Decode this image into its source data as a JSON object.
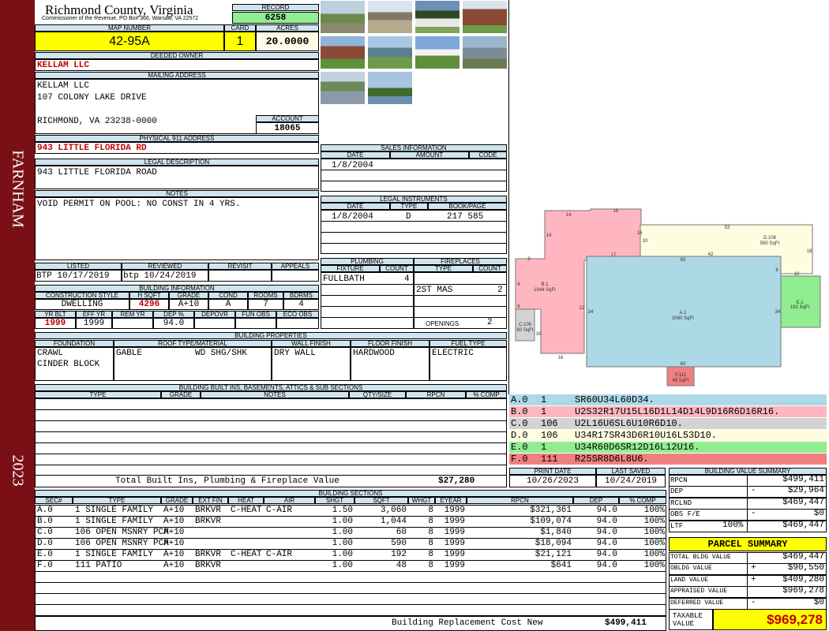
{
  "sidebar": {
    "town": "FARNHAM",
    "year": "2023"
  },
  "header": {
    "county": "Richmond County, Virginia",
    "commissioner": "Commissioner of the Revenue, PO Box 366, Warsaw, VA 22572",
    "record_label": "RECORD",
    "record": "6258",
    "map_label": "MAP NUMBER",
    "map_number": "42-95A",
    "card_label": "CARD",
    "card": "1",
    "acres_label": "ACRES",
    "acres": "20.0000"
  },
  "owner": {
    "deeded_label": "DEEDED OWNER",
    "deeded": "KELLAM LLC",
    "mailing_label": "MAILING ADDRESS",
    "mail_line1": "KELLAM LLC",
    "mail_line2": "107 COLONY LAKE DRIVE",
    "mail_line3": "RICHMOND, VA 23238-0000",
    "account_label": "ACCOUNT",
    "account": "18065",
    "phys_label": "PHYSICAL 911 ADDRESS",
    "phys": "943 LITTLE FLORIDA RD",
    "legal_label": "LEGAL DESCRIPTION",
    "legal": "943 LITTLE FLORIDA ROAD",
    "notes_label": "NOTES",
    "notes": "VOID PERMIT ON POOL: NO CONST IN 4 YRS."
  },
  "status": {
    "listed_label": "LISTED",
    "listed": "BTP 10/17/2019",
    "reviewed_label": "REVIEWED",
    "reviewed": "btp 10/24/2019",
    "revisit_label": "REVISIT",
    "appeals_label": "APPEALS"
  },
  "building_info": {
    "label": "BUILDING INFORMATION",
    "cols": [
      "CONSTRUCTION STYLE",
      "H SQFT",
      "GRADE",
      "COND",
      "ROOMS",
      "BDRMS"
    ],
    "vals": [
      "DWELLING",
      "4296",
      "A+10",
      "A",
      "7",
      "4"
    ],
    "cols2": [
      "YR BLT",
      "EFF YR",
      "REM YR",
      "DEP %",
      "DEPOVR",
      "FUN OBS",
      "ECO OBS"
    ],
    "vals2": [
      "1999",
      "1999",
      "",
      "94.0",
      "",
      "",
      ""
    ]
  },
  "sales": {
    "label": "SALES INFORMATION",
    "cols": [
      "DATE",
      "AMOUNT",
      "CODE"
    ],
    "rows": [
      {
        "date": "1/8/2004",
        "amount": "",
        "code": ""
      }
    ]
  },
  "legal_instr": {
    "label": "LEGAL INSTRUMENTS",
    "cols": [
      "DATE",
      "TYPE",
      "BOOK/PAGE"
    ],
    "rows": [
      {
        "date": "1/8/2004",
        "type": "D",
        "book": "217 585"
      }
    ]
  },
  "plumbing": {
    "label": "PLUMBING",
    "cols": [
      "FIXTURE",
      "COUNT"
    ],
    "rows": [
      {
        "fixture": "FULLBATH",
        "count": "4"
      }
    ]
  },
  "fireplaces": {
    "label": "FIREPLACES",
    "cols": [
      "TYPE",
      "COUNT"
    ],
    "rows": [
      {
        "type": "2ST MAS",
        "count": "2"
      }
    ],
    "openings_label": "OPENINGS",
    "openings": "2"
  },
  "properties": {
    "label": "BUILDING PROPERTIES",
    "cols": [
      "FOUNDATION",
      "ROOF TYPE/MATERIAL",
      "WALL FINISH",
      "FLOOR FINISH",
      "FUEL TYPE"
    ],
    "foundation": [
      "CRAWL",
      "CINDER BLOCK"
    ],
    "roof_type": "GABLE",
    "roof_mat": "WD SHG/SHK",
    "wall": "DRY WALL",
    "floor": "HARDWOOD",
    "fuel": "ELECTRIC"
  },
  "builtins": {
    "label": "BUILDING BUILT INS, BASEMENTS, ATTICS & SUB SECTIONS",
    "cols": [
      "TYPE",
      "GRADE",
      "NOTES",
      "QTY/SIZE",
      "RPCN",
      "% COMP"
    ],
    "total_label": "Total Built Ins, Plumbing & Fireplace Value",
    "total": "$27,280"
  },
  "sketch": {
    "areas": [
      {
        "label": "B.1",
        "sub": "1044 SqFt"
      },
      {
        "label": "D.106",
        "sub": "590 SqFt"
      },
      {
        "label": "A.1",
        "sub": "3060 SqFt"
      },
      {
        "label": "E.1",
        "sub": "192 SqFt"
      },
      {
        "label": "C.106",
        "sub": "60 SqFt"
      },
      {
        "label": "F.111",
        "sub": "48 SqFt"
      }
    ],
    "dims": [
      "14",
      "16",
      "14",
      "16",
      "10",
      "53",
      "D.106",
      "42",
      "18",
      "60",
      "17",
      "9",
      "6",
      "22",
      "34",
      "34",
      "10",
      "8",
      "16",
      "16",
      "60",
      "6"
    ],
    "codes": [
      {
        "id": "A.0",
        "n": "1",
        "code": "SR60U34L60D34.",
        "color": "#add8e6"
      },
      {
        "id": "B.0",
        "n": "1",
        "code": "U2S32R17U15L16D1L14D14L9D16R6D16R16.",
        "color": "#ffb6c1"
      },
      {
        "id": "C.0",
        "n": "106",
        "code": "U2L16U6SL6U10R6D10.",
        "color": "#d3d3d3"
      },
      {
        "id": "D.0",
        "n": "106",
        "code": "U34R17SR43D6R10U16L53D10.",
        "color": "#fffde0"
      },
      {
        "id": "E.0",
        "n": "1",
        "code": "U34R60D6SR12D16L12U16.",
        "color": "#90ee90"
      },
      {
        "id": "F.0",
        "n": "111",
        "code": "R25SR8D6L8U6.",
        "color": "#f08080"
      }
    ]
  },
  "print": {
    "print_label": "PRINT DATE",
    "print_date": "10/26/2023",
    "saved_label": "LAST SAVED",
    "saved": "10/24/2019"
  },
  "bvs": {
    "label": "BUILDING VALUE SUMMARY",
    "rows": [
      {
        "k": "RPCN",
        "sign": "",
        "pct": "",
        "v": "$499,411"
      },
      {
        "k": "DEP",
        "sign": "-",
        "pct": "",
        "v": "$29,964"
      },
      {
        "k": "RCLND",
        "sign": "",
        "pct": "",
        "v": "$469,447"
      },
      {
        "k": "OBS F/E",
        "sign": "-",
        "pct": "",
        "v": "$0"
      },
      {
        "k": "LTF",
        "sign": "",
        "pct": "100%",
        "v": "$469,447"
      }
    ]
  },
  "parcel": {
    "label": "PARCEL SUMMARY",
    "rows": [
      {
        "k": "TOTAL BLDG VALUE",
        "sign": "",
        "v": "$469,447"
      },
      {
        "k": "OBLDG VALUE",
        "sign": "+",
        "v": "$90,550"
      },
      {
        "k": "LAND VALUE",
        "sign": "+",
        "v": "$409,280"
      },
      {
        "k": "APPRAISED VALUE",
        "sign": "",
        "v": "$969,278"
      },
      {
        "k": "DEFERRED VALUE",
        "sign": "-",
        "v": "$0"
      }
    ],
    "taxable_label": "TAXABLE VALUE",
    "taxable": "$969,278"
  },
  "sections": {
    "label": "BUILDING SECTIONS",
    "cols": [
      "SEC#",
      "TYPE",
      "GRADE",
      "EXT FIN",
      "HEAT",
      "AIR",
      "SHGT",
      "SQFT",
      "WHGT",
      "EYEAR",
      "RPCN",
      "DEP",
      "% COMP"
    ],
    "rows": [
      {
        "sec": "A.0",
        "type": "1 SINGLE FAMILY",
        "grade": "A+10",
        "ext": "BRKVR",
        "heat": "C-HEAT",
        "air": "C-AIR",
        "shgt": "1.50",
        "sqft": "3,060",
        "whgt": "8",
        "eyear": "1999",
        "rpcn": "$321,361",
        "dep": "94.0",
        "comp": "100%"
      },
      {
        "sec": "B.0",
        "type": "1 SINGLE FAMILY",
        "grade": "A+10",
        "ext": "BRKVR",
        "heat": "",
        "air": "",
        "shgt": "1.00",
        "sqft": "1,044",
        "whgt": "8",
        "eyear": "1999",
        "rpcn": "$109,074",
        "dep": "94.0",
        "comp": "100%"
      },
      {
        "sec": "C.0",
        "type": "106 OPEN MSNRY PCH",
        "grade": "A+10",
        "ext": "",
        "heat": "",
        "air": "",
        "shgt": "1.00",
        "sqft": "60",
        "whgt": "8",
        "eyear": "1999",
        "rpcn": "$1,840",
        "dep": "94.0",
        "comp": "100%"
      },
      {
        "sec": "D.0",
        "type": "106 OPEN MSNRY PCH",
        "grade": "A+10",
        "ext": "",
        "heat": "",
        "air": "",
        "shgt": "1.00",
        "sqft": "590",
        "whgt": "8",
        "eyear": "1999",
        "rpcn": "$18,094",
        "dep": "94.0",
        "comp": "100%"
      },
      {
        "sec": "E.0",
        "type": "1 SINGLE FAMILY",
        "grade": "A+10",
        "ext": "BRKVR",
        "heat": "C-HEAT",
        "air": "C-AIR",
        "shgt": "1.00",
        "sqft": "192",
        "whgt": "8",
        "eyear": "1999",
        "rpcn": "$21,121",
        "dep": "94.0",
        "comp": "100%"
      },
      {
        "sec": "F.0",
        "type": "111 PATIO",
        "grade": "A+10",
        "ext": "BRKVR",
        "heat": "",
        "air": "",
        "shgt": "1.00",
        "sqft": "48",
        "whgt": "8",
        "eyear": "1999",
        "rpcn": "$641",
        "dep": "94.0",
        "comp": "100%"
      }
    ],
    "total_label": "Building Replacement Cost New",
    "total": "$499,411"
  },
  "colors": {
    "sidebar": "#7a1016",
    "header_bg": "#cfe4ee",
    "map_bg": "#ffff00",
    "record_bg": "#90ee90",
    "accent_red": "#c00000"
  }
}
